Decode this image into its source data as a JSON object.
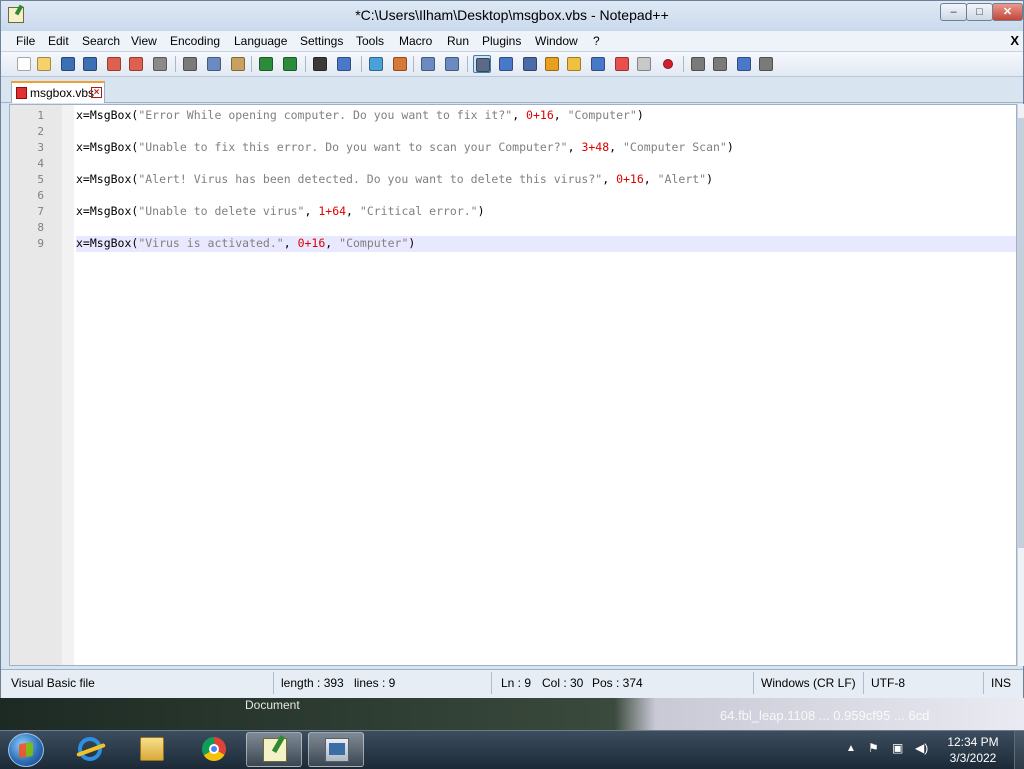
{
  "window": {
    "title": "*C:\\Users\\Ilham\\Desktop\\msgbox.vbs - Notepad++",
    "controls": {
      "minimize": "–",
      "maximize": "□",
      "close": "✕"
    }
  },
  "menu": {
    "items": [
      "File",
      "Edit",
      "Search",
      "View",
      "Encoding",
      "Language",
      "Settings",
      "Tools",
      "Macro",
      "Run",
      "Plugins",
      "Window",
      "?"
    ],
    "close_glyph": "X"
  },
  "toolbar": {
    "icons": [
      "new-file-icon",
      "open-file-icon",
      "save-icon",
      "save-all-icon",
      "close-icon",
      "close-all-icon",
      "print-icon",
      "cut-icon",
      "copy-icon",
      "paste-icon",
      "undo-icon",
      "redo-icon",
      "find-icon",
      "replace-icon",
      "zoom-in-icon",
      "zoom-out-icon",
      "sync-vertical-icon",
      "sync-horizontal-icon",
      "word-wrap-icon",
      "show-all-chars-icon",
      "indent-guide-icon",
      "user-defined-language-icon",
      "document-map-icon",
      "function-list-icon",
      "folder-workspace-icon",
      "monitoring-icon",
      "record-macro-icon",
      "stop-macro-icon",
      "play-macro-icon",
      "run-macro-multiple-icon",
      "save-macro-icon"
    ]
  },
  "tabs": [
    {
      "label": "msgbox.vbs",
      "close": "×",
      "active": true,
      "modified": true
    }
  ],
  "editor": {
    "lines": [
      {
        "num": "1",
        "parts": [
          [
            "x=MsgBox(",
            "op"
          ],
          [
            "\"Error While opening computer. Do you want to fix it?\"",
            "str"
          ],
          [
            ", ",
            "op"
          ],
          [
            "0+16",
            "num"
          ],
          [
            ", ",
            "op"
          ],
          [
            "\"Computer\"",
            "str"
          ],
          [
            ")",
            "op"
          ]
        ]
      },
      {
        "num": "2",
        "parts": []
      },
      {
        "num": "3",
        "parts": [
          [
            "x=MsgBox(",
            "op"
          ],
          [
            "\"Unable to fix this error. Do you want to scan your Computer?\"",
            "str"
          ],
          [
            ", ",
            "op"
          ],
          [
            "3+48",
            "num"
          ],
          [
            ", ",
            "op"
          ],
          [
            "\"Computer Scan\"",
            "str"
          ],
          [
            ")",
            "op"
          ]
        ]
      },
      {
        "num": "4",
        "parts": []
      },
      {
        "num": "5",
        "parts": [
          [
            "x=MsgBox(",
            "op"
          ],
          [
            "\"Alert! Virus has been detected. Do you want to delete this virus?\"",
            "str"
          ],
          [
            ", ",
            "op"
          ],
          [
            "0+16",
            "num"
          ],
          [
            ", ",
            "op"
          ],
          [
            "\"Alert\"",
            "str"
          ],
          [
            ")",
            "op"
          ]
        ]
      },
      {
        "num": "6",
        "parts": []
      },
      {
        "num": "7",
        "parts": [
          [
            "x=MsgBox(",
            "op"
          ],
          [
            "\"Unable to delete virus\"",
            "str"
          ],
          [
            ", ",
            "op"
          ],
          [
            "1+64",
            "num"
          ],
          [
            ", ",
            "op"
          ],
          [
            "\"Critical error.\"",
            "str"
          ],
          [
            ")",
            "op"
          ]
        ]
      },
      {
        "num": "8",
        "parts": []
      },
      {
        "num": "9",
        "parts": [
          [
            "x=MsgBox(",
            "op"
          ],
          [
            "\"Virus is activated.\"",
            "str"
          ],
          [
            ", ",
            "op"
          ],
          [
            "0+16",
            "num"
          ],
          [
            ", ",
            "op"
          ],
          [
            "\"Computer\"",
            "str"
          ],
          [
            ")",
            "op"
          ]
        ],
        "current": true
      }
    ]
  },
  "status": {
    "file_type": "Visual Basic file",
    "length": "length : 393",
    "lines": "lines : 9",
    "ln": "Ln : 9",
    "col": "Col : 30",
    "pos": "Pos : 374",
    "eol": "Windows (CR LF)",
    "encoding": "UTF-8",
    "mode": "INS"
  },
  "background": {
    "document_label": "Document",
    "overlay_text": "64.fbl_leap.1108 ... 0.959cf95 ... 6cd"
  },
  "taskbar": {
    "apps": [
      "internet-explorer-icon",
      "file-explorer-icon",
      "chrome-icon",
      "notepadpp-icon",
      "performance-monitor-icon"
    ],
    "clock_time": "12:34 PM",
    "clock_date": "3/3/2022"
  }
}
